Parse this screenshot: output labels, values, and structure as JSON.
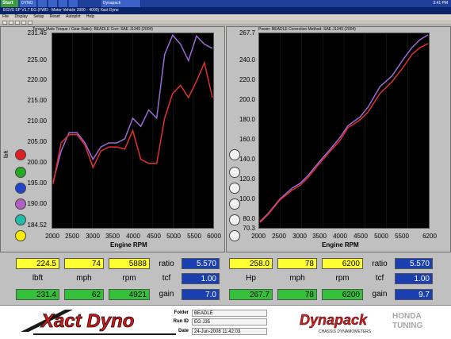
{
  "taskbar": {
    "start_label": "Start",
    "tasks": [
      "DYNO",
      "",
      "",
      "",
      "",
      "Dynapack"
    ],
    "clock": "3:41 PM"
  },
  "window": {
    "title": "EGVS SP V1.7 EG  (FWD - Motor Vehicle 2000 - 4000)  Xact Dyno"
  },
  "menu": [
    "File",
    "Display",
    "Setup",
    "Reset",
    "Autoplot",
    "Help"
  ],
  "left_panel": {
    "header": "Torque (Axle Torque / Gear Ratio): BEADLE     Corr: SAE J1349 (2004)",
    "ylabel": "lbft",
    "xlabel": "Engine RPM",
    "yticks": [
      "231.45",
      "225.00",
      "220.00",
      "215.00",
      "210.00",
      "205.00",
      "200.00",
      "195.00",
      "190.00",
      "184.52"
    ],
    "xticks": [
      "2000",
      "2500",
      "3000",
      "3500",
      "4000",
      "4500",
      "5000",
      "5500",
      "6000"
    ],
    "dot_colors": [
      "#e02020",
      "#22aa22",
      "#2244cc",
      "#b060c0",
      "#22bbaa",
      "#ffee00"
    ]
  },
  "right_panel": {
    "header": "Power: BEADLE     Correction Method: SAE J1349 (2004)",
    "ylabel": "Hp",
    "xlabel": "Engine RPM",
    "yticks": [
      "267.7",
      "240.0",
      "220.0",
      "200.0",
      "180.0",
      "160.0",
      "140.0",
      "120.0",
      "100.0",
      "80.0",
      "70.3"
    ],
    "xticks": [
      "2000",
      "2500",
      "3000",
      "3500",
      "4000",
      "4500",
      "5000",
      "5500",
      "6200"
    ],
    "dot_colors": [
      "#ffffff",
      "#ffffff",
      "#ffffff",
      "#ffffff",
      "#ffffff",
      "#ffffff"
    ]
  },
  "chart_data": [
    {
      "type": "line",
      "xlabel": "Engine RPM",
      "ylabel": "lbft",
      "xlim": [
        2000,
        6000
      ],
      "ylim": [
        184.52,
        231.45
      ],
      "series": [
        {
          "color": "#9a6ad8",
          "x": [
            2000,
            2200,
            2400,
            2600,
            2800,
            3000,
            3200,
            3400,
            3600,
            3800,
            4000,
            4200,
            4400,
            4600,
            4800,
            5000,
            5200,
            5400,
            5600,
            5800,
            6000
          ],
          "values": [
            195.5,
            203,
            207.5,
            207.5,
            205,
            201,
            204,
            205,
            205,
            206,
            211,
            209,
            213,
            211,
            226.5,
            231.2,
            229,
            225,
            231,
            229,
            228
          ]
        },
        {
          "color": "#e23030",
          "x": [
            2000,
            2200,
            2400,
            2600,
            2800,
            3000,
            3200,
            3400,
            3600,
            3800,
            4000,
            4200,
            4400,
            4600,
            4800,
            5000,
            5200,
            5400,
            5600,
            5800,
            6000
          ],
          "values": [
            195,
            205,
            207,
            207,
            204.5,
            199,
            203,
            204,
            204,
            203.5,
            208,
            201,
            200,
            200,
            211,
            217,
            219,
            216,
            220,
            224.5,
            216
          ]
        }
      ]
    },
    {
      "type": "line",
      "xlabel": "Engine RPM",
      "ylabel": "Hp",
      "xlim": [
        2000,
        6200
      ],
      "ylim": [
        70.3,
        267.7
      ],
      "series": [
        {
          "color": "#9a6ad8",
          "x": [
            2000,
            2200,
            2500,
            2800,
            3000,
            3200,
            3500,
            3800,
            4000,
            4200,
            4500,
            4700,
            5000,
            5300,
            5600,
            5800,
            6000,
            6200
          ],
          "values": [
            76,
            84,
            99,
            110,
            115,
            123,
            138,
            152,
            162,
            174,
            183,
            193,
            214,
            225,
            243,
            254,
            262,
            267
          ]
        },
        {
          "color": "#e23030",
          "x": [
            2000,
            2200,
            2500,
            2800,
            3000,
            3200,
            3500,
            3800,
            4000,
            4200,
            4500,
            4700,
            5000,
            5300,
            5600,
            5800,
            6000,
            6200
          ],
          "values": [
            75,
            83,
            98,
            108,
            113,
            121,
            136,
            150,
            159,
            172,
            180,
            188,
            207,
            219,
            235,
            247,
            254,
            258
          ]
        }
      ]
    }
  ],
  "readouts": {
    "left": {
      "row1": [
        "224.5",
        "74",
        "5888"
      ],
      "units": [
        "lbft",
        "mph",
        "rpm"
      ],
      "row3": [
        "231.4",
        "62",
        "4921"
      ],
      "ratio_label": "ratio",
      "ratio": "5.570",
      "tcf_label": "tcf",
      "tcf": "1.00",
      "gain_label": "gain",
      "gain": "7.0"
    },
    "right": {
      "row1": [
        "258.0",
        "78",
        "6200"
      ],
      "units": [
        "Hp",
        "mph",
        "rpm"
      ],
      "row3": [
        "267.7",
        "78",
        "6200"
      ],
      "ratio_label": "ratio",
      "ratio": "5.570",
      "tcf_label": "tcf",
      "tcf": "1.00",
      "gain_label": "gain",
      "gain": "9.7"
    }
  },
  "footer": {
    "xact_logo": "Xact Dyno",
    "folder_label": "Folder",
    "folder": "BEADLE",
    "runid_label": "Run ID",
    "runid": "EG J35",
    "date_label": "Date",
    "date": "24-Jun-2008  11:42:03",
    "dyna_logo": "Dynapack",
    "dyna_sub": "CHASSIS DYNAMOMETERS",
    "watermark1": "HONDA",
    "watermark2": "TUNING"
  }
}
